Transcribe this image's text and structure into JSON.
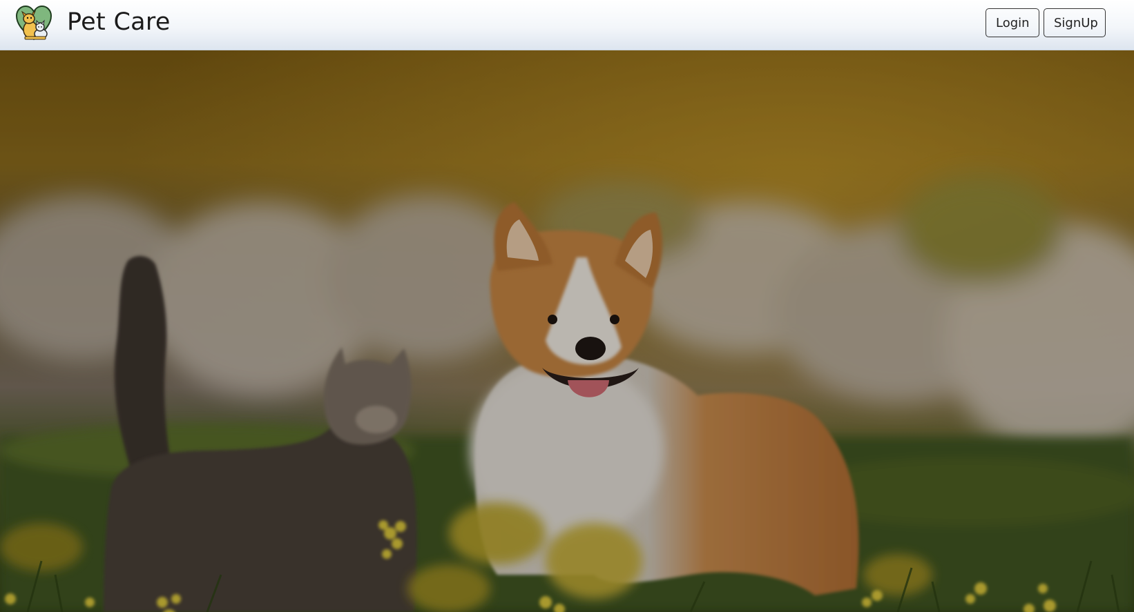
{
  "navbar": {
    "brand_title": "Pet Care",
    "logo_icon": "pet-logo-icon",
    "login_label": "Login",
    "signup_label": "SignUp"
  },
  "hero": {
    "image": "dog-and-cat-in-meadow-photo",
    "overlay_color": "#000000"
  },
  "colors": {
    "navbar_bg_top": "#ffffff",
    "navbar_bg_bottom": "#dde5ef",
    "button_border": "#333333",
    "text": "#1b1b1b"
  }
}
